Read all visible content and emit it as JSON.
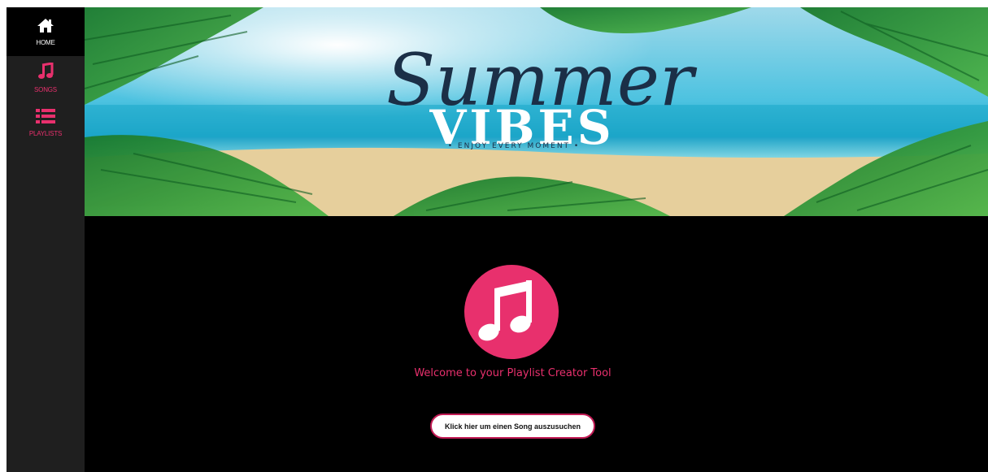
{
  "sidebar": {
    "items": [
      {
        "label": "HOME",
        "icon": "home-icon"
      },
      {
        "label": "SONGS",
        "icon": "music-note-icon"
      },
      {
        "label": "PLAYLISTS",
        "icon": "list-icon"
      }
    ]
  },
  "banner": {
    "script_text": "Summer",
    "headline": "VIBES",
    "tagline": "• ENJOY EVERY MOMENT •"
  },
  "main": {
    "logo_icon": "music-note-icon",
    "welcome": "Welcome to your Playlist Creator Tool",
    "cta_label": "Klick hier um einen Song auszusuchen"
  },
  "colors": {
    "accent": "#e8306d",
    "sidebar_bg": "#1f1f1f",
    "active_bg": "#000000",
    "main_bg": "#000000"
  }
}
